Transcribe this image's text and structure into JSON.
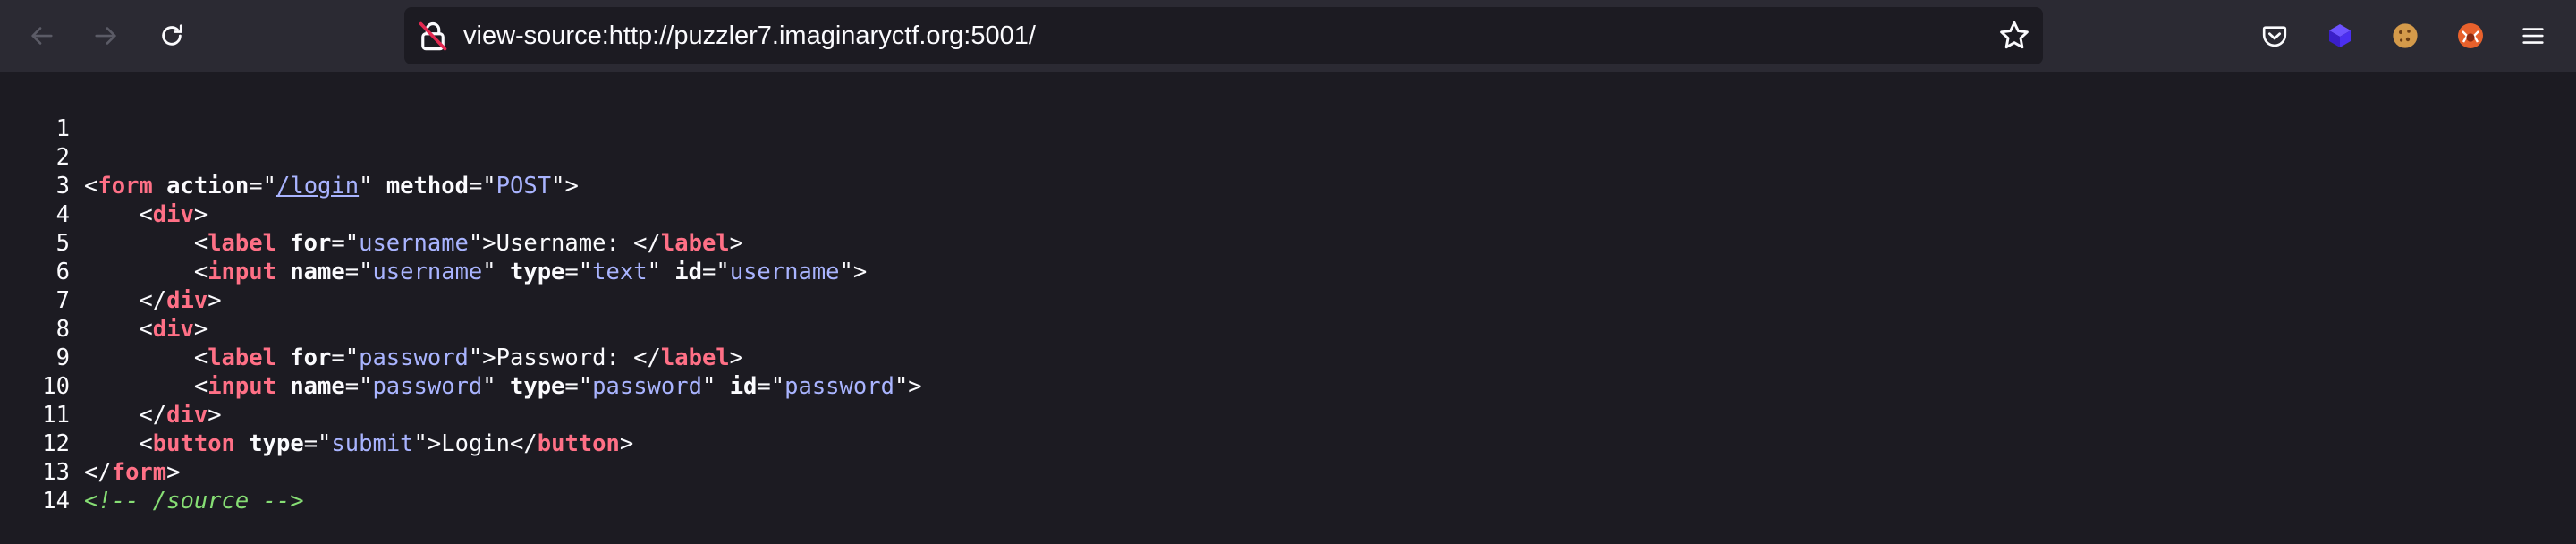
{
  "browser": {
    "url": "view-source:http://puzzler7.imaginaryctf.org:5001/",
    "icons": {
      "back": "arrow-left-icon",
      "forward": "arrow-right-icon",
      "reload": "reload-icon",
      "lock": "insecure-lock-icon",
      "bookmark": "star-icon",
      "pocket": "pocket-icon",
      "extension1": "cube-extension-icon",
      "extension2": "cookie-icon",
      "extension3": "fox-extension-icon",
      "menu": "hamburger-menu-icon"
    }
  },
  "source": {
    "line_numbers": [
      "1",
      "2",
      "3",
      "4",
      "5",
      "6",
      "7",
      "8",
      "9",
      "10",
      "11",
      "12",
      "13",
      "14"
    ],
    "l2": {
      "open": "<",
      "tag": "form",
      "a1": "action",
      "eq1": "=\"",
      "v1": "/login",
      "q1": "\"",
      "a2": "method",
      "eq2": "=\"",
      "v2": "POST",
      "close": "\">"
    },
    "l3": {
      "indent": "    ",
      "open": "<",
      "tag": "div",
      "close": ">"
    },
    "l4": {
      "indent": "        ",
      "open": "<",
      "tag": "label",
      "a1": "for",
      "eq1": "=\"",
      "v1": "username",
      "close": "\">",
      "text": "Username: ",
      "end_open": "</",
      "end_tag": "label",
      "end_close": ">"
    },
    "l5": {
      "indent": "        ",
      "open": "<",
      "tag": "input",
      "a1": "name",
      "eq1": "=\"",
      "v1": "username",
      "q1": "\"",
      "a2": "type",
      "eq2": "=\"",
      "v2": "text",
      "q2": "\"",
      "a3": "id",
      "eq3": "=\"",
      "v3": "username",
      "close": "\">"
    },
    "l6": {
      "indent": "    ",
      "open": "</",
      "tag": "div",
      "close": ">"
    },
    "l7": {
      "indent": "    ",
      "open": "<",
      "tag": "div",
      "close": ">"
    },
    "l8": {
      "indent": "        ",
      "open": "<",
      "tag": "label",
      "a1": "for",
      "eq1": "=\"",
      "v1": "password",
      "close": "\">",
      "text": "Password: ",
      "end_open": "</",
      "end_tag": "label",
      "end_close": ">"
    },
    "l9": {
      "indent": "        ",
      "open": "<",
      "tag": "input",
      "a1": "name",
      "eq1": "=\"",
      "v1": "password",
      "q1": "\"",
      "a2": "type",
      "eq2": "=\"",
      "v2": "password",
      "q2": "\"",
      "a3": "id",
      "eq3": "=\"",
      "v3": "password",
      "close": "\">"
    },
    "l10": {
      "indent": "    ",
      "open": "</",
      "tag": "div",
      "close": ">"
    },
    "l11": {
      "indent": "    ",
      "open": "<",
      "tag": "button",
      "a1": "type",
      "eq1": "=\"",
      "v1": "submit",
      "close": "\">",
      "text": "Login",
      "end_open": "</",
      "end_tag": "button",
      "end_close": ">"
    },
    "l12": {
      "open": "</",
      "tag": "form",
      "close": ">"
    },
    "l13": {
      "comment": "<!-- /source -->"
    }
  },
  "colors": {
    "toolbar_bg": "#2b2a33",
    "page_bg": "#1c1b22",
    "tag": "#ff7086",
    "attr_value": "#a9b4ff",
    "comment": "#86de74",
    "text": "#fbfbfe"
  }
}
